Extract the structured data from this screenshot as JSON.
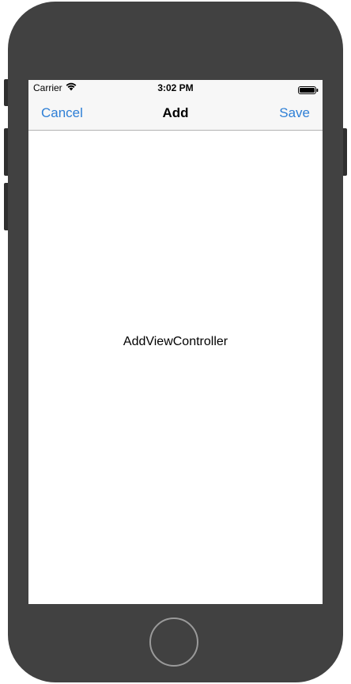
{
  "device": {
    "body_color": "#414141"
  },
  "status_bar": {
    "carrier": "Carrier",
    "wifi_icon": "wifi-icon",
    "time": "3:02 PM",
    "battery_icon": "battery-icon"
  },
  "nav_bar": {
    "cancel_label": "Cancel",
    "title": "Add",
    "save_label": "Save",
    "tint_color": "#2e7fd6"
  },
  "content": {
    "label": "AddViewController"
  }
}
